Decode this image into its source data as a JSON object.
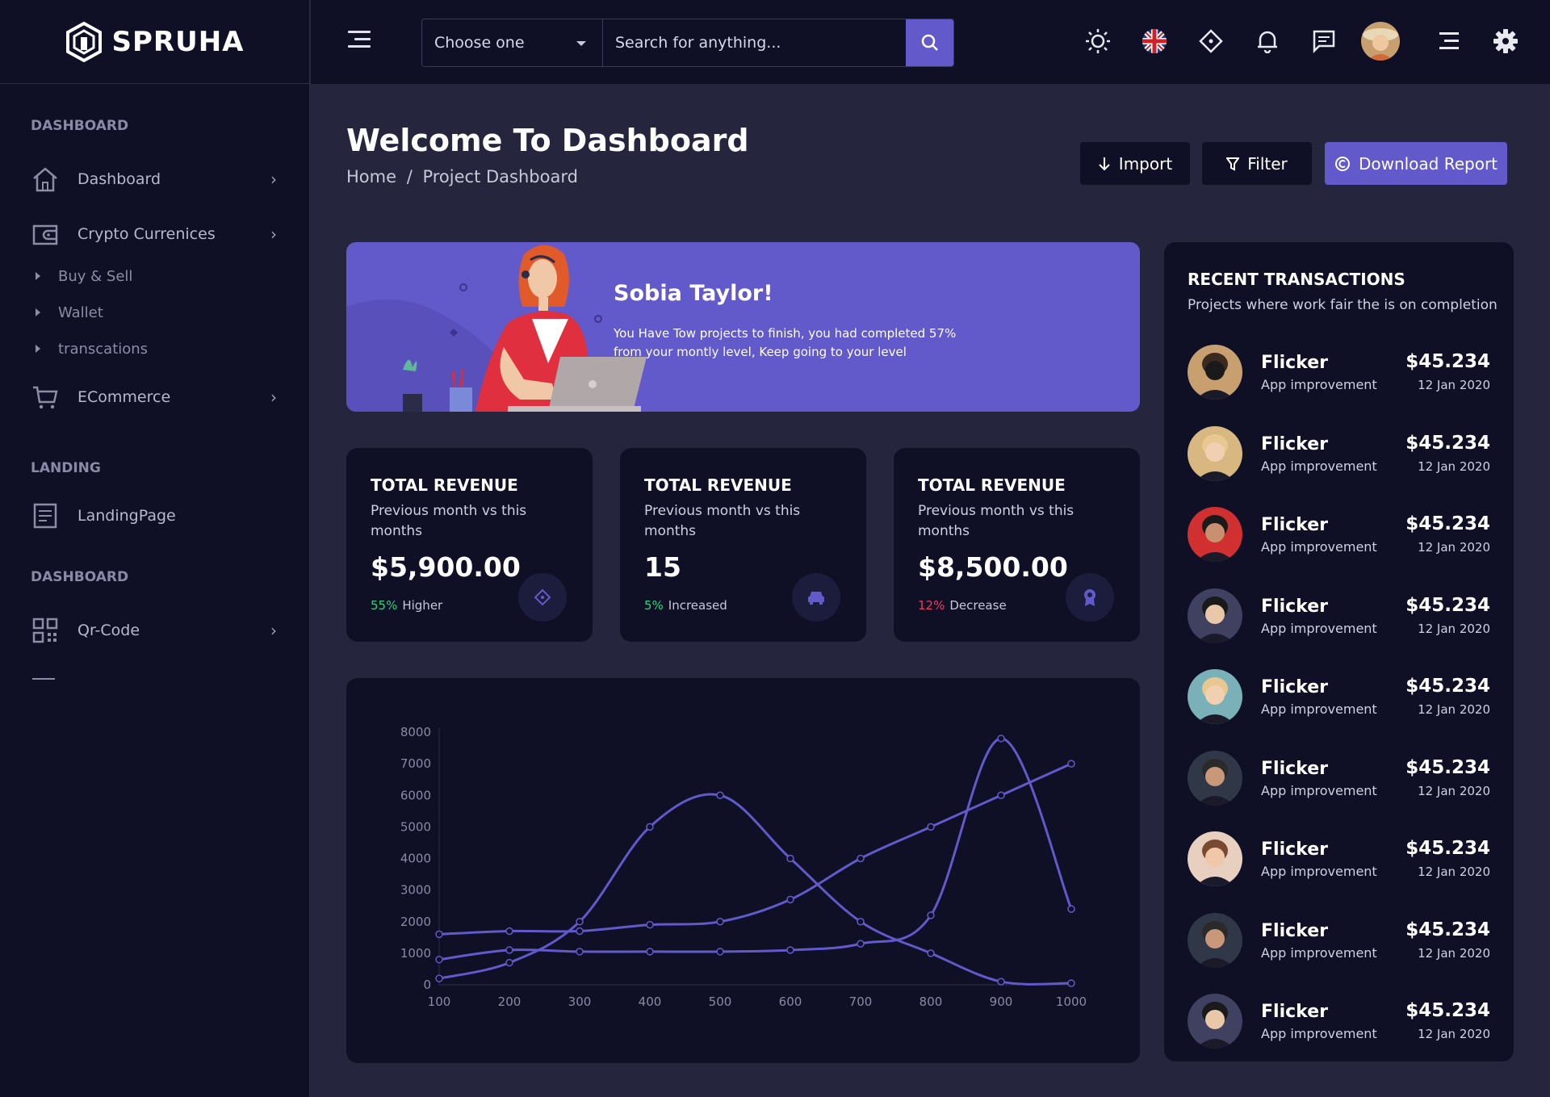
{
  "brand": {
    "name": "SPRUHA"
  },
  "colors": {
    "accent": "#6259ca",
    "panel": "#0f0f26",
    "background": "#25253e",
    "positive": "#2bd47b",
    "negative": "#f23d5e"
  },
  "sidebar": {
    "sections": [
      "DASHBOARD",
      "LANDING",
      "DASHBOARD"
    ],
    "items": [
      {
        "label": "Dashboard",
        "icon": "home-icon"
      },
      {
        "label": "Crypto Currenices",
        "icon": "wallet-icon"
      },
      {
        "label": "ECommerce",
        "icon": "cart-icon"
      },
      {
        "label": "LandingPage",
        "icon": "document-icon"
      },
      {
        "label": "Qr-Code",
        "icon": "qr-code-icon"
      }
    ],
    "sub_items": [
      "Buy & Sell",
      "Wallet",
      "transcations"
    ]
  },
  "header": {
    "select_value": "Choose one",
    "search_placeholder": "Search for anything...",
    "icons": [
      "sun-icon",
      "uk-flag-icon",
      "fullscreen-icon",
      "bell-icon",
      "chat-icon",
      "avatar",
      "menu-icon",
      "gear-icon"
    ]
  },
  "page": {
    "title": "Welcome To Dashboard",
    "breadcrumb_home": "Home",
    "breadcrumb_sep": "/",
    "breadcrumb_current": "Project Dashboard",
    "buttons": {
      "import": "Import",
      "filter": "Filter",
      "download": "Download Report"
    }
  },
  "banner": {
    "name": "Sobia Taylor!",
    "text": "You Have Tow projects to finish, you had completed 57% from your montly level, Keep going to your level"
  },
  "stats": [
    {
      "title": "TOTAL REVENUE",
      "sub": "Previous month vs this months",
      "value": "$5,900.00",
      "pct": "55%",
      "trend": "Higher",
      "icon": "target-icon"
    },
    {
      "title": "TOTAL REVENUE",
      "sub": "Previous month vs this months",
      "value": "15",
      "pct": "5%",
      "trend": "Increased",
      "icon": "car-icon"
    },
    {
      "title": "TOTAL REVENUE",
      "sub": "Previous month vs this months",
      "value": "$8,500.00",
      "pct": "12%",
      "trend": "Decrease",
      "icon": "award-icon"
    }
  ],
  "chart_data": {
    "type": "line",
    "x": [
      100,
      200,
      300,
      400,
      500,
      600,
      700,
      800,
      900,
      1000
    ],
    "ylim": [
      0,
      8000
    ],
    "yticks": [
      0,
      1000,
      2000,
      3000,
      4000,
      5000,
      6000,
      7000,
      8000
    ],
    "grid": false,
    "series": [
      {
        "values": [
          1600,
          1700,
          1700,
          1900,
          2000,
          2700,
          4000,
          5000,
          6000,
          7000
        ]
      },
      {
        "values": [
          200,
          700,
          2000,
          5000,
          6000,
          4000,
          2000,
          1000,
          100,
          50
        ]
      },
      {
        "values": [
          800,
          1100,
          1050,
          1050,
          1050,
          1100,
          1300,
          2200,
          7800,
          2400
        ]
      }
    ]
  },
  "transactions": {
    "title": "RECENT TRANSACTIONS",
    "subtitle": "Projects where work fair the is on completion",
    "rows": [
      {
        "name": "Flicker",
        "desc": "App improvement",
        "amount": "$45.234",
        "date": "12 Jan 2020"
      },
      {
        "name": "Flicker",
        "desc": "App improvement",
        "amount": "$45.234",
        "date": "12 Jan 2020"
      },
      {
        "name": "Flicker",
        "desc": "App improvement",
        "amount": "$45.234",
        "date": "12 Jan 2020"
      },
      {
        "name": "Flicker",
        "desc": "App improvement",
        "amount": "$45.234",
        "date": "12 Jan 2020"
      },
      {
        "name": "Flicker",
        "desc": "App improvement",
        "amount": "$45.234",
        "date": "12 Jan 2020"
      },
      {
        "name": "Flicker",
        "desc": "App improvement",
        "amount": "$45.234",
        "date": "12 Jan 2020"
      },
      {
        "name": "Flicker",
        "desc": "App improvement",
        "amount": "$45.234",
        "date": "12 Jan 2020"
      },
      {
        "name": "Flicker",
        "desc": "App improvement",
        "amount": "$45.234",
        "date": "12 Jan 2020"
      },
      {
        "name": "Flicker",
        "desc": "App improvement",
        "amount": "$45.234",
        "date": "12 Jan 2020"
      }
    ]
  }
}
